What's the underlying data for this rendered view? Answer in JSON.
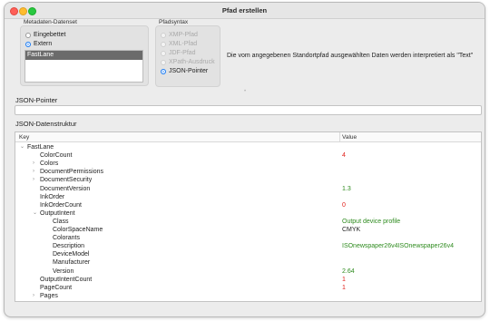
{
  "window": {
    "title": "Pfad erstellen"
  },
  "metadata_group": {
    "label": "Metadaten-Datenset",
    "options": [
      {
        "label": "Eingebettet",
        "selected": false
      },
      {
        "label": "Extern",
        "selected": true
      }
    ],
    "list_items": [
      "FastLane"
    ]
  },
  "syntax_group": {
    "label": "Pfadsyntax",
    "options": [
      {
        "label": "XMP-Pfad",
        "selected": false,
        "enabled": false
      },
      {
        "label": "XML-Pfad",
        "selected": false,
        "enabled": false
      },
      {
        "label": "JDF-Pfad",
        "selected": false,
        "enabled": false
      },
      {
        "label": "XPath-Ausdruck",
        "selected": false,
        "enabled": false
      },
      {
        "label": "JSON-Pointer",
        "selected": true,
        "enabled": true
      }
    ]
  },
  "info_text": "Die vom angegebenen Standortpfad ausgewählten Daten werden interpretiert als \"Text\"",
  "separator_glyph": "•",
  "json_pointer": {
    "label": "JSON-Pointer",
    "value": ""
  },
  "structure": {
    "label": "JSON-Datenstruktur",
    "columns": [
      "Key",
      "Value"
    ],
    "rows": [
      {
        "key": "FastLane",
        "value": "",
        "level": 0,
        "disclosure": "open",
        "value_color": "black"
      },
      {
        "key": "ColorCount",
        "value": "4",
        "level": 1,
        "disclosure": "",
        "value_color": "red"
      },
      {
        "key": "Colors",
        "value": "",
        "level": 1,
        "disclosure": "closed",
        "value_color": "black"
      },
      {
        "key": "DocumentPermissions",
        "value": "",
        "level": 1,
        "disclosure": "closed",
        "value_color": "black"
      },
      {
        "key": "DocumentSecurity",
        "value": "",
        "level": 1,
        "disclosure": "closed",
        "value_color": "black"
      },
      {
        "key": "DocumentVersion",
        "value": "1.3",
        "level": 1,
        "disclosure": "",
        "value_color": "green"
      },
      {
        "key": "InkOrder",
        "value": "",
        "level": 1,
        "disclosure": "",
        "value_color": "black"
      },
      {
        "key": "InkOrderCount",
        "value": "0",
        "level": 1,
        "disclosure": "",
        "value_color": "red"
      },
      {
        "key": "OutputIntent",
        "value": "",
        "level": 1,
        "disclosure": "open",
        "value_color": "black"
      },
      {
        "key": "Class",
        "value": "Output device profile",
        "level": 2,
        "disclosure": "",
        "value_color": "green"
      },
      {
        "key": "ColorSpaceName",
        "value": "CMYK",
        "level": 2,
        "disclosure": "",
        "value_color": "black"
      },
      {
        "key": "Colorants",
        "value": "",
        "level": 2,
        "disclosure": "",
        "value_color": "black"
      },
      {
        "key": "Description",
        "value": "ISOnewspaper26v4ISOnewspaper26v4",
        "level": 2,
        "disclosure": "",
        "value_color": "green"
      },
      {
        "key": "DeviceModel",
        "value": "",
        "level": 2,
        "disclosure": "",
        "value_color": "black"
      },
      {
        "key": "Manufacturer",
        "value": "",
        "level": 2,
        "disclosure": "",
        "value_color": "black"
      },
      {
        "key": "Version",
        "value": "2.64",
        "level": 2,
        "disclosure": "",
        "value_color": "green"
      },
      {
        "key": "OutputIntentCount",
        "value": "1",
        "level": 1,
        "disclosure": "",
        "value_color": "red"
      },
      {
        "key": "PageCount",
        "value": "1",
        "level": 1,
        "disclosure": "",
        "value_color": "red"
      },
      {
        "key": "Pages",
        "value": "",
        "level": 1,
        "disclosure": "closed",
        "value_color": "black"
      }
    ]
  }
}
